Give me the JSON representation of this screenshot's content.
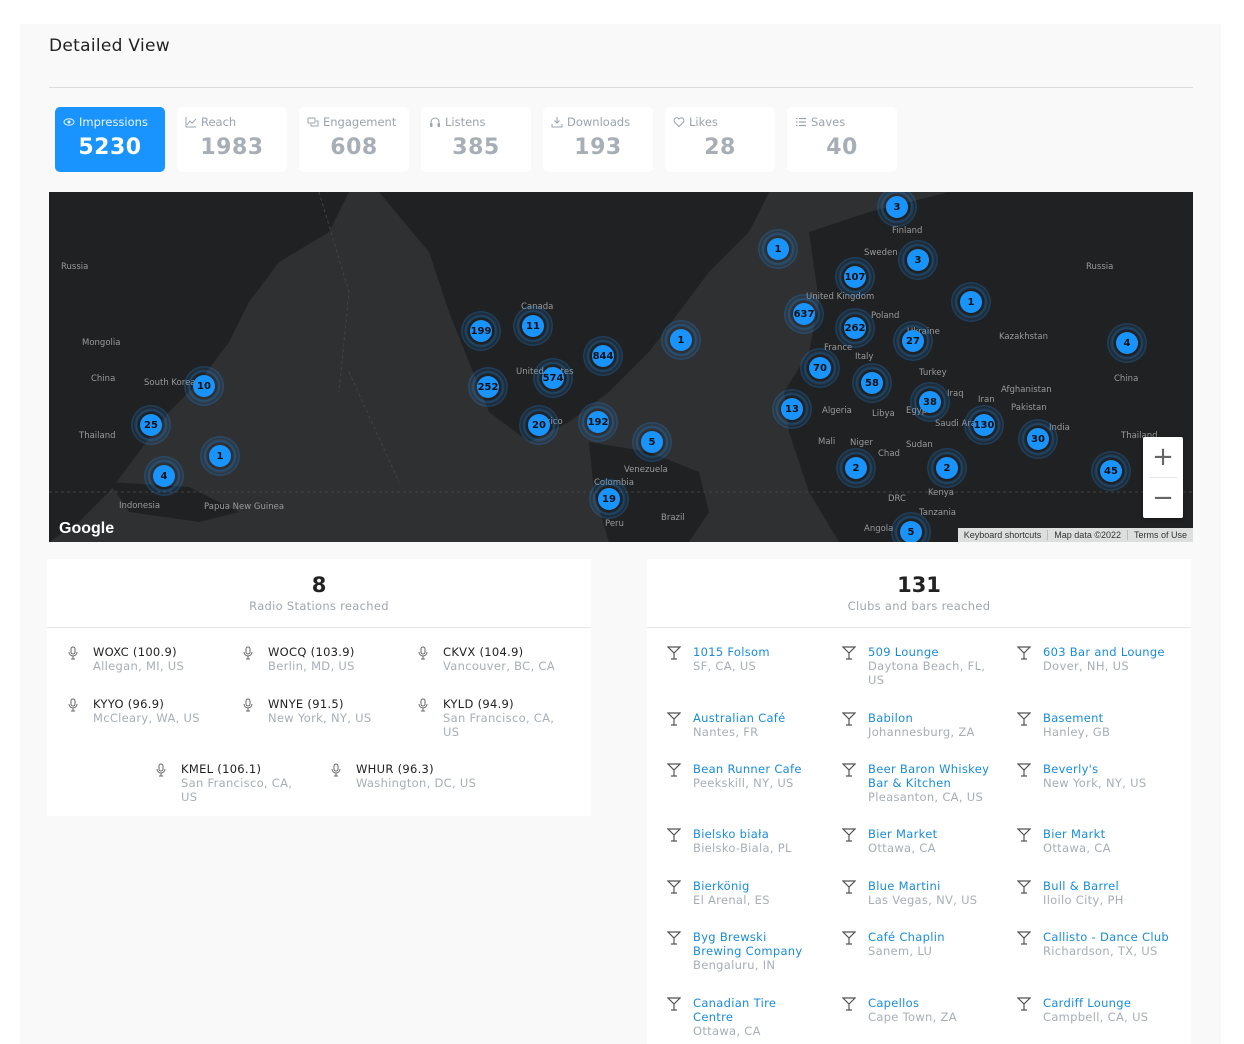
{
  "page": {
    "title": "Detailed View"
  },
  "stats": [
    {
      "label": "Impressions",
      "value": "5230",
      "icon": "eye-icon"
    },
    {
      "label": "Reach",
      "value": "1983",
      "icon": "chart-line-icon"
    },
    {
      "label": "Engagement",
      "value": "608",
      "icon": "comments-icon"
    },
    {
      "label": "Listens",
      "value": "385",
      "icon": "headphones-icon"
    },
    {
      "label": "Downloads",
      "value": "193",
      "icon": "download-icon"
    },
    {
      "label": "Likes",
      "value": "28",
      "icon": "heart-icon"
    },
    {
      "label": "Saves",
      "value": "40",
      "icon": "list-icon"
    }
  ],
  "map": {
    "labels": [
      "Russia",
      "Mongolia",
      "China",
      "South Korea",
      "Thailand",
      "Indonesia",
      "Papua New Guinea",
      "Canada",
      "United States",
      "Mexico",
      "Venezuela",
      "Colombia",
      "Peru",
      "Brazil",
      "Finland",
      "Sweden",
      "United Kingdom",
      "Poland",
      "Ukraine",
      "France",
      "Italy",
      "Turkey",
      "Algeria",
      "Libya",
      "Egypt",
      "Iraq",
      "Iran",
      "Saudi Arabia",
      "Mali",
      "Niger",
      "Chad",
      "Sudan",
      "DRC",
      "Kenya",
      "Tanzania",
      "Angola",
      "Kazakhstan",
      "Afghanistan",
      "Pakistan",
      "India",
      "Russia",
      "China",
      "Thailand"
    ],
    "clusters": [
      "3",
      "1",
      "107",
      "3",
      "1",
      "637",
      "262",
      "27",
      "199",
      "11",
      "1",
      "844",
      "574",
      "252",
      "70",
      "58",
      "10",
      "25",
      "1",
      "4",
      "20",
      "192",
      "5",
      "19",
      "13",
      "38",
      "130",
      "30",
      "4",
      "2",
      "2",
      "45",
      "5"
    ],
    "zoom_in": "+",
    "zoom_out": "−",
    "google": "Google",
    "attribution": [
      "Keyboard shortcuts",
      "Map data ©2022",
      "Terms of Use"
    ]
  },
  "radio": {
    "count": "8",
    "subtitle": "Radio Stations reached",
    "items": [
      {
        "name": "WOXC (100.9)",
        "location": "Allegan, MI, US"
      },
      {
        "name": "WOCQ (103.9)",
        "location": "Berlin, MD, US"
      },
      {
        "name": "CKVX (104.9)",
        "location": "Vancouver, BC, CA"
      },
      {
        "name": "KYYO (96.9)",
        "location": "McCleary, WA, US"
      },
      {
        "name": "WNYE (91.5)",
        "location": "New York, NY, US"
      },
      {
        "name": "KYLD (94.9)",
        "location": "San Francisco, CA, US"
      },
      {
        "name": "KMEL (106.1)",
        "location": "San Francisco, CA, US"
      },
      {
        "name": "WHUR (96.3)",
        "location": "Washington, DC, US"
      }
    ]
  },
  "clubs": {
    "count": "131",
    "subtitle": "Clubs and bars reached",
    "items": [
      {
        "name": "1015 Folsom",
        "location": "SF, CA, US"
      },
      {
        "name": "509 Lounge",
        "location": "Daytona Beach, FL, US"
      },
      {
        "name": "603 Bar and Lounge",
        "location": "Dover, NH, US"
      },
      {
        "name": "Australian Café",
        "location": "Nantes, FR"
      },
      {
        "name": "Babilon",
        "location": "Johannesburg, ZA"
      },
      {
        "name": "Basement",
        "location": "Hanley, GB"
      },
      {
        "name": "Bean Runner Cafe",
        "location": "Peekskill, NY, US"
      },
      {
        "name": "Beer Baron Whiskey Bar & Kitchen",
        "location": "Pleasanton, CA, US"
      },
      {
        "name": "Beverly's",
        "location": "New York, NY, US"
      },
      {
        "name": "Bielsko biała",
        "location": "Bielsko-Biala, PL"
      },
      {
        "name": "Bier Market",
        "location": "Ottawa, CA"
      },
      {
        "name": "Bier Markt",
        "location": "Ottawa, CA"
      },
      {
        "name": "Bierkönig",
        "location": "El Arenal, ES"
      },
      {
        "name": "Blue Martini",
        "location": "Las Vegas, NV, US"
      },
      {
        "name": "Bull & Barrel",
        "location": "Iloilo City, PH"
      },
      {
        "name": "Byg Brewski Brewing Company",
        "location": "Bengaluru, IN"
      },
      {
        "name": "Café Chaplin",
        "location": "Sanem, LU"
      },
      {
        "name": "Callisto - Dance Club",
        "location": "Richardson, TX, US"
      },
      {
        "name": "Canadian Tire Centre",
        "location": "Ottawa, CA"
      },
      {
        "name": "Capellos",
        "location": "Cape Town, ZA"
      },
      {
        "name": "Cardiff Lounge",
        "location": "Campbell, CA, US"
      }
    ]
  }
}
